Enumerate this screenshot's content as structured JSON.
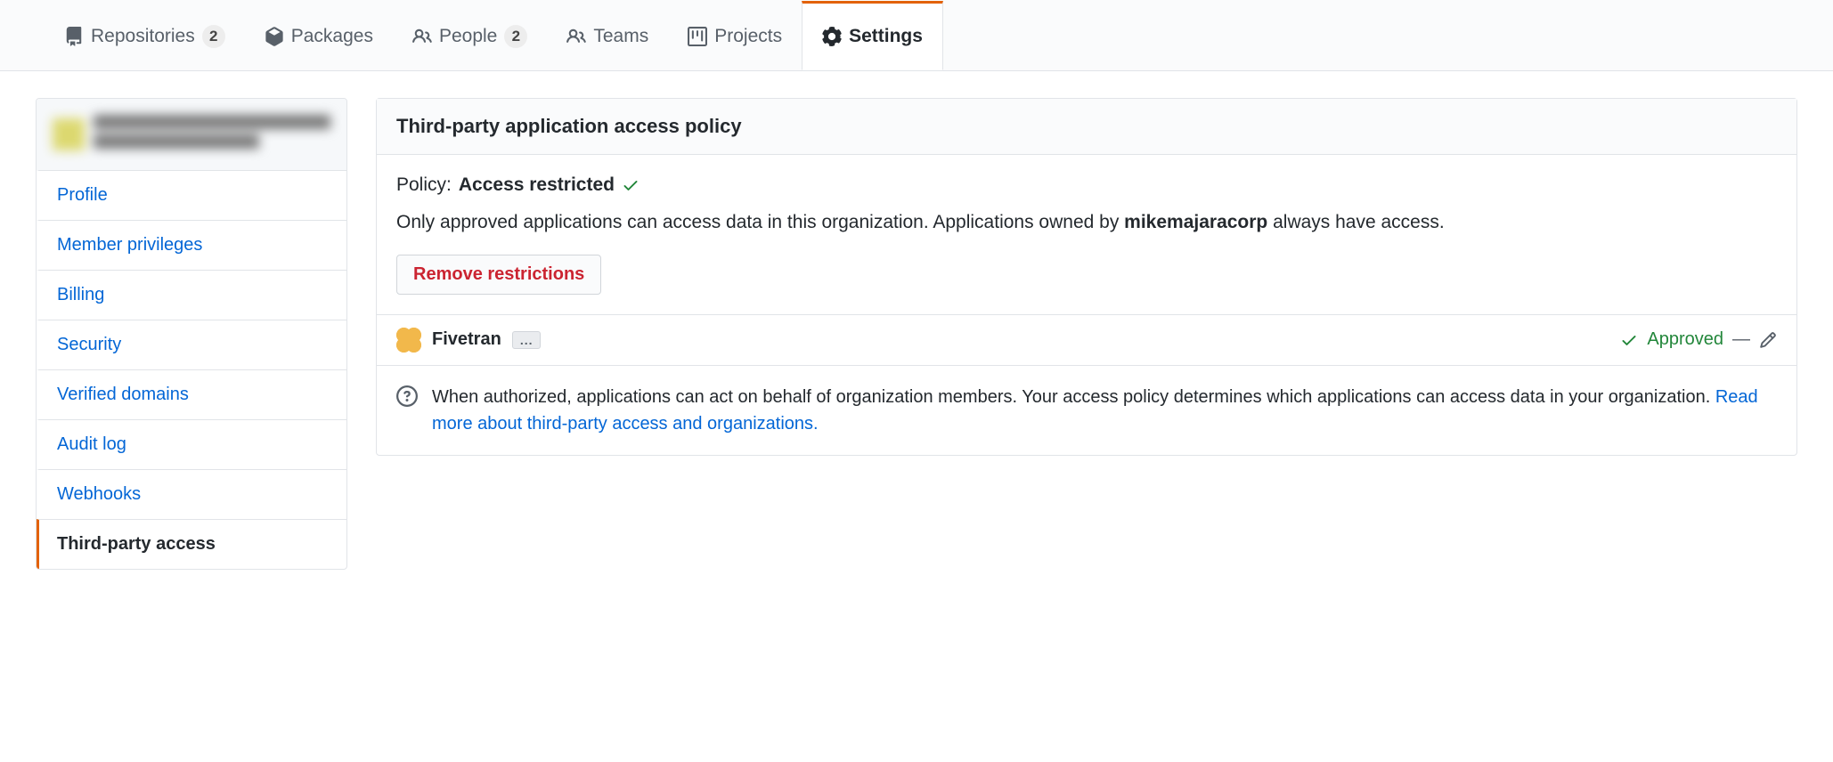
{
  "topnav": {
    "items": [
      {
        "label": "Repositories",
        "count": "2"
      },
      {
        "label": "Packages"
      },
      {
        "label": "People",
        "count": "2"
      },
      {
        "label": "Teams"
      },
      {
        "label": "Projects"
      },
      {
        "label": "Settings",
        "active": true
      }
    ]
  },
  "sidebar": {
    "items": [
      {
        "label": "Profile"
      },
      {
        "label": "Member privileges"
      },
      {
        "label": "Billing"
      },
      {
        "label": "Security"
      },
      {
        "label": "Verified domains"
      },
      {
        "label": "Audit log"
      },
      {
        "label": "Webhooks"
      },
      {
        "label": "Third-party access",
        "active": true
      }
    ]
  },
  "panel": {
    "title": "Third-party application access policy",
    "policy_label": "Policy:",
    "policy_status": "Access restricted",
    "description_prefix": "Only approved applications can access data in this organization. Applications owned by ",
    "org_name": "mikemajaracorp",
    "description_suffix": " always have access.",
    "remove_button": "Remove restrictions"
  },
  "app": {
    "name": "Fivetran",
    "ellipsis": "...",
    "status": "Approved",
    "dash": "—"
  },
  "info": {
    "text": "When authorized, applications can act on behalf of organization members. Your access policy determines which applications can access data in your organization. ",
    "link": "Read more about third-party access and organizations."
  }
}
